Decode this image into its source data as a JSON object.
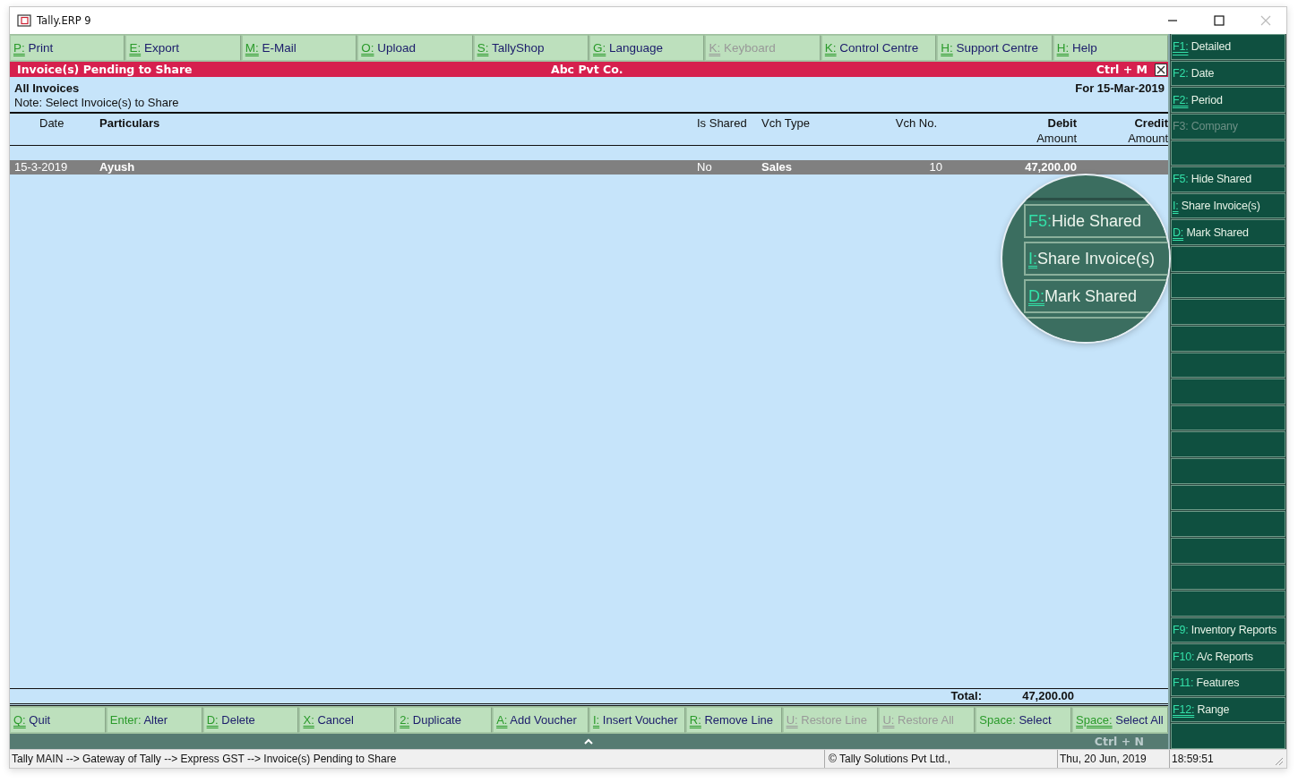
{
  "window": {
    "title": "Tally.ERP 9"
  },
  "top_buttons": [
    {
      "key": "P:",
      "label": "Print",
      "underline": true,
      "disabled": false
    },
    {
      "key": "E:",
      "label": "Export",
      "underline": true,
      "disabled": false
    },
    {
      "key": "M:",
      "label": "E-Mail",
      "underline": true,
      "disabled": false
    },
    {
      "key": "O:",
      "label": "Upload",
      "underline": true,
      "disabled": false
    },
    {
      "key": "S:",
      "label": "TallyShop",
      "underline": true,
      "disabled": false
    },
    {
      "key": "G:",
      "label": "Language",
      "underline": true,
      "disabled": false
    },
    {
      "key": "K:",
      "label": "Keyboard",
      "underline": true,
      "disabled": true
    },
    {
      "key": "K:",
      "label": "Control Centre",
      "underline": true,
      "disabled": false
    },
    {
      "key": "H:",
      "label": "Support Centre",
      "underline": true,
      "disabled": false
    },
    {
      "key": "H:",
      "label": "Help",
      "underline": true,
      "disabled": false
    }
  ],
  "report_bar": {
    "title": "Invoice(s) Pending to Share",
    "company": "Abc Pvt Co.",
    "shortcut": "Ctrl + M"
  },
  "report": {
    "heading": "All Invoices",
    "note": "Note: Select Invoice(s) to Share",
    "period": "For 15-Mar-2019"
  },
  "table": {
    "columns": [
      {
        "label": "Date",
        "bold": false
      },
      {
        "label": "Particulars",
        "bold": true
      },
      {
        "label": "Is Shared",
        "bold": false
      },
      {
        "label": "Vch Type",
        "bold": false
      },
      {
        "label": "Vch No.",
        "bold": false
      },
      {
        "label": "Debit",
        "sub": "Amount",
        "bold": true
      },
      {
        "label": "Credit",
        "sub": "Amount",
        "bold": true
      }
    ],
    "rows": [
      {
        "date": "15-3-2019",
        "particulars": "Ayush",
        "is_shared": "No",
        "vch_type": "Sales",
        "vch_no": "10",
        "debit": "47,200.00",
        "selected": true
      }
    ],
    "total_label": "Total:",
    "total_debit": "47,200.00"
  },
  "bottom_buttons": [
    {
      "key": "Q:",
      "label": "Quit",
      "underline": true,
      "disabled": false
    },
    {
      "key": "Enter:",
      "label": "Alter",
      "underline": false,
      "disabled": false
    },
    {
      "key": "D:",
      "label": "Delete",
      "underline": true,
      "disabled": false
    },
    {
      "key": "X:",
      "label": "Cancel",
      "underline": true,
      "disabled": false
    },
    {
      "key": "2:",
      "label": "Duplicate",
      "underline": true,
      "disabled": false
    },
    {
      "key": "A:",
      "label": "Add Voucher",
      "underline": true,
      "disabled": false
    },
    {
      "key": "I:",
      "label": "Insert Voucher",
      "underline": true,
      "disabled": false
    },
    {
      "key": "R:",
      "label": "Remove Line",
      "underline": true,
      "disabled": false
    },
    {
      "key": "U:",
      "label": "Restore Line",
      "underline": true,
      "disabled": true
    },
    {
      "key": "U:",
      "label": "Restore All",
      "underline": true,
      "disabled": true
    },
    {
      "key": "Space:",
      "label": "Select",
      "underline": false,
      "disabled": false
    },
    {
      "key": "Space:",
      "label": "Select All",
      "underline": true,
      "disabled": false
    }
  ],
  "bottom_bar": {
    "shortcut": "Ctrl + N"
  },
  "side_buttons": [
    {
      "kind": "button",
      "key": "F1:",
      "label": "Detailed",
      "underline": true,
      "disabled": false
    },
    {
      "kind": "button",
      "key": "F2:",
      "label": "Date",
      "underline": false,
      "disabled": false
    },
    {
      "kind": "button",
      "key": "F2:",
      "label": "Period",
      "underline": true,
      "disabled": false
    },
    {
      "kind": "button",
      "key": "F3:",
      "label": "Company",
      "underline": false,
      "disabled": true
    },
    {
      "kind": "blank"
    },
    {
      "kind": "button",
      "key": "F5:",
      "label": "Hide Shared",
      "underline": false,
      "disabled": false
    },
    {
      "kind": "button",
      "key": "I:",
      "label": "Share Invoice(s)",
      "underline": true,
      "disabled": false
    },
    {
      "kind": "button",
      "key": "D:",
      "label": "Mark Shared",
      "underline": true,
      "disabled": false
    },
    {
      "kind": "blank"
    },
    {
      "kind": "blank"
    },
    {
      "kind": "blank"
    },
    {
      "kind": "blank"
    },
    {
      "kind": "blank"
    },
    {
      "kind": "blank"
    },
    {
      "kind": "blank"
    },
    {
      "kind": "blank"
    },
    {
      "kind": "blank"
    },
    {
      "kind": "blank"
    },
    {
      "kind": "blank"
    },
    {
      "kind": "blank"
    },
    {
      "kind": "blank"
    },
    {
      "kind": "blank"
    },
    {
      "kind": "button",
      "key": "F9:",
      "label": "Inventory Reports",
      "underline": false,
      "disabled": false
    },
    {
      "kind": "button",
      "key": "F10:",
      "label": "A/c Reports",
      "underline": false,
      "disabled": false
    },
    {
      "kind": "button",
      "key": "F11:",
      "label": "Features",
      "underline": false,
      "disabled": false
    },
    {
      "kind": "button",
      "key": "F12:",
      "label": "Range",
      "underline": true,
      "disabled": false
    },
    {
      "kind": "blank"
    }
  ],
  "magnifier": {
    "items": [
      {
        "key": "F5:",
        "label": "Hide Shared",
        "underline": false
      },
      {
        "key": "I:",
        "label": "Share Invoice(s)",
        "underline": true
      },
      {
        "key": "D:",
        "label": "Mark Shared",
        "underline": true
      }
    ]
  },
  "status_bar": {
    "path": "Tally MAIN --> Gateway of Tally --> Express GST --> Invoice(s) Pending to Share",
    "copyright": "© Tally Solutions Pvt Ltd.,",
    "date": "Thu, 20 Jun, 2019",
    "time": "18:59:51"
  }
}
